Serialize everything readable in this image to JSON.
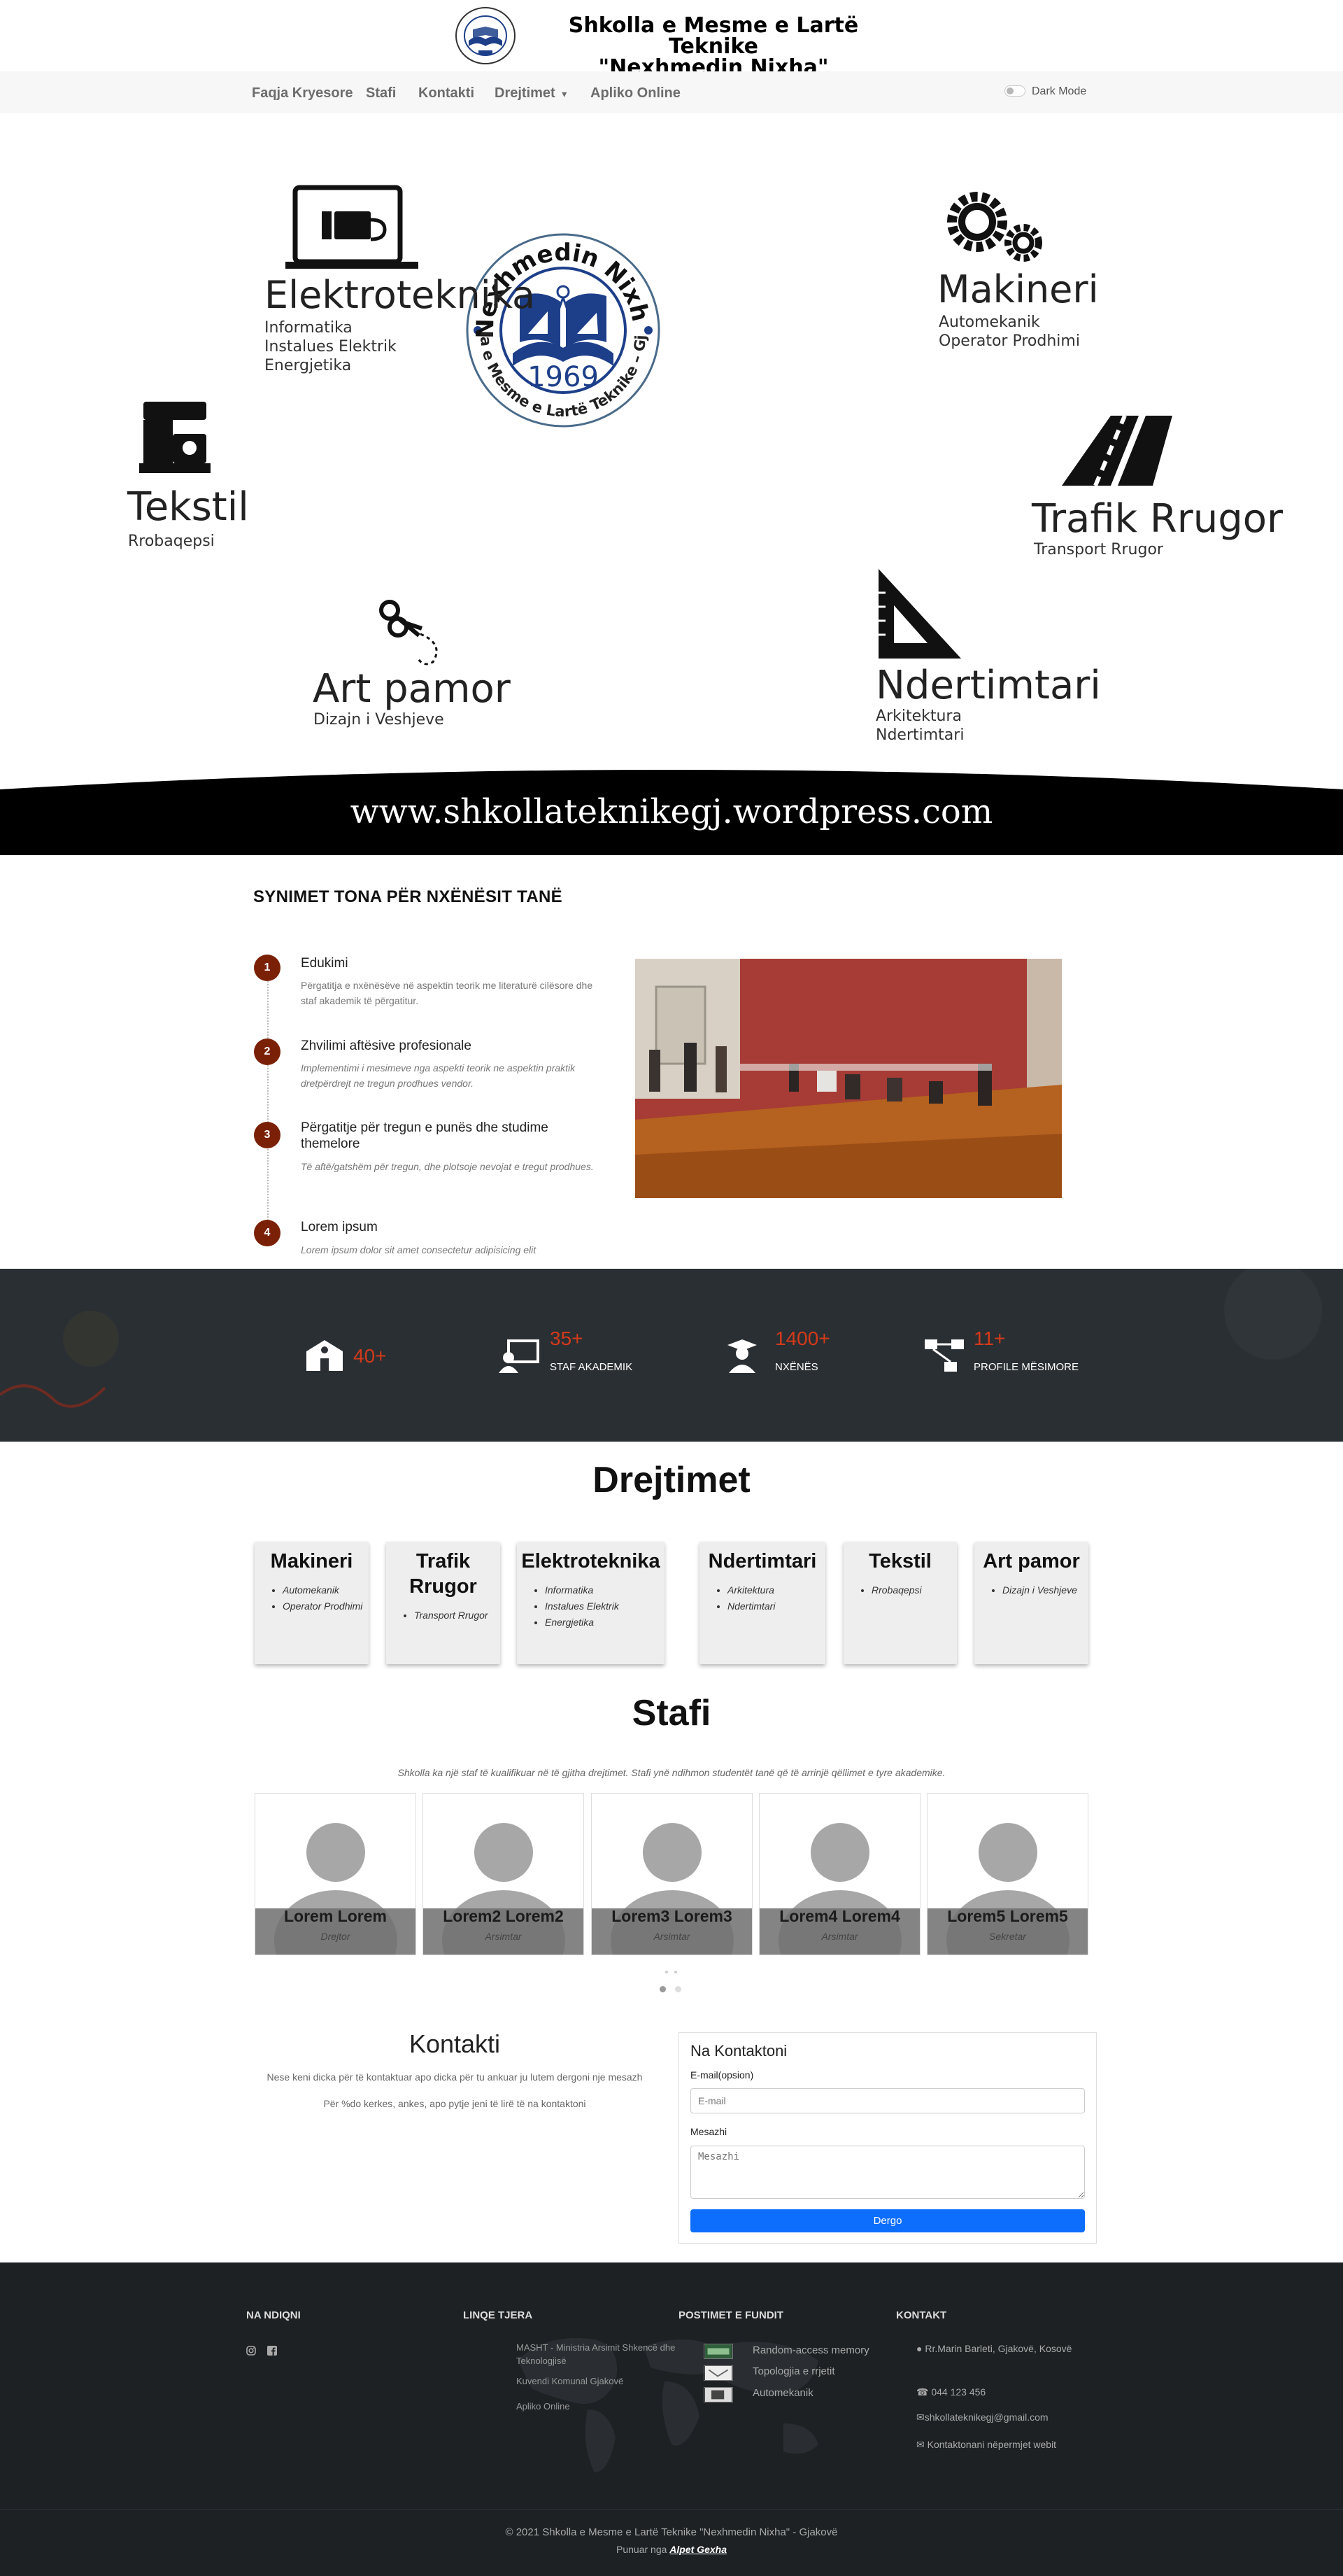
{
  "header": {
    "title_line1": "Shkolla e Mesme e Lartë Teknike",
    "title_line2": "\"Nexhmedin Nixha\"",
    "logo_text": "\"NEXHMEDIN NIXHA\" 1969"
  },
  "nav": {
    "items": [
      "Faqja Kryesore",
      "Stafi",
      "Kontakti",
      "Drejtimet",
      "Apliko Online"
    ],
    "dropdown_caret": "▾",
    "dark_mode_label": "Dark Mode"
  },
  "hero": {
    "emblem": {
      "top_arc": "\"Nexhmedin Nixha\"",
      "bottom_arc": "Shkolla e Mesme e Lartë Teknike – Gjakovë",
      "year": "1969"
    },
    "fields": [
      {
        "title": "Elektroteknika",
        "subs": [
          "Informatika",
          "Instalues Elektrik",
          "Energjetika"
        ]
      },
      {
        "title": "Makineri",
        "subs": [
          "Automekanik",
          "Operator Prodhimi"
        ]
      },
      {
        "title": "Tekstil",
        "subs": [
          "Rrobaqepsi"
        ]
      },
      {
        "title": "Trafik Rrugor",
        "subs": [
          "Transport Rrugor"
        ]
      },
      {
        "title": "Art pamor",
        "subs": [
          "Dizajn i Veshjeve"
        ]
      },
      {
        "title": "Ndertimtari",
        "subs": [
          "Arkitektura",
          "Ndertimtari"
        ]
      }
    ],
    "url": "www.shkollateknikegj.wordpress.com"
  },
  "goals": {
    "heading": "SYNIMET TONA PËR NXËNËSIT TANË",
    "steps": [
      {
        "num": "1",
        "title": "Edukimi",
        "desc": "Përgatitja e nxënësëve në aspektin teorik me literaturë cilësore dhe staf akademik të përgatitur."
      },
      {
        "num": "2",
        "title": "Zhvilimi aftësive profesionale",
        "desc": "Implementimi i mesimeve nga aspekti teorik ne aspektin praktik dretpërdrejt ne tregun prodhues vendor."
      },
      {
        "num": "3",
        "title": "Përgatitje për tregun e punës dhe studime themelore",
        "desc": "Të aftë/gatshëm për tregun, dhe plotsoje nevojat e tregut prodhues."
      },
      {
        "num": "4",
        "title": "Lorem ipsum",
        "desc": "Lorem ipsum dolor sit amet consectetur adipisicing elit"
      }
    ]
  },
  "stats": [
    {
      "icon": "school-icon",
      "number": "40+",
      "label": ""
    },
    {
      "icon": "teacher-icon",
      "number": "35+",
      "label": "STAF AKADEMIK"
    },
    {
      "icon": "student-icon",
      "number": "1400+",
      "label": "NXËNËS"
    },
    {
      "icon": "sitemap-icon",
      "number": "11+",
      "label": "PROFILE MËSIMORE"
    }
  ],
  "directions": {
    "heading": "Drejtimet",
    "cards": [
      {
        "title": "Makineri",
        "items": [
          "Automekanik",
          "Operator Prodhimi"
        ]
      },
      {
        "title": "Trafik Rrugor",
        "items": [
          "Transport Rrugor"
        ]
      },
      {
        "title": "Elektroteknika",
        "items": [
          "Informatika",
          "Instalues Elektrik",
          "Energjetika"
        ]
      },
      {
        "title": "Ndertimtari",
        "items": [
          "Arkitektura",
          "Ndertimtari"
        ]
      },
      {
        "title": "Tekstil",
        "items": [
          "Rrobaqepsi"
        ]
      },
      {
        "title": "Art pamor",
        "items": [
          "Dizajn i Veshjeve"
        ]
      }
    ]
  },
  "staff": {
    "heading": "Stafi",
    "intro": "Shkolla ka një staf të kualifikuar në të gjitha drejtimet. Stafi ynë ndihmon studentët tanë që të arrinjë qëllimet e tyre akademike.",
    "members": [
      {
        "name": "Lorem Lorem",
        "role": "Drejtor"
      },
      {
        "name": "Lorem2 Lorem2",
        "role": "Arsimtar"
      },
      {
        "name": "Lorem3 Lorem3",
        "role": "Arsimtar"
      },
      {
        "name": "Lorem4 Lorem4",
        "role": "Arsimtar"
      },
      {
        "name": "Lorem5 Lorem5",
        "role": "Sekretar"
      }
    ]
  },
  "contact": {
    "heading": "Kontakti",
    "text1": "Nese keni dicka për të kontaktuar apo dicka për tu ankuar ju lutem dergoni nje mesazh",
    "text2": "Për %do kerkes, ankes, apo pytje jeni të lirë të na kontaktoni",
    "form_title": "Na Kontaktoni",
    "email_label": "E-mail(opsion)",
    "email_placeholder": "E-mail",
    "message_label": "Mesazhi",
    "message_placeholder": "Mesazhi",
    "send_label": "Dergo"
  },
  "footer": {
    "follow_heading": "NA NDIQNI",
    "links_heading": "LINQE TJERA",
    "links": [
      "MASHT - Ministria Arsimit Shkencë dhe Teknologjisë",
      "Kuvendi Komunal Gjakovë",
      "Apliko Online"
    ],
    "posts_heading": "POSTIMET E FUNDIT",
    "posts": [
      "Random-access memory",
      "Topologjia e rrjetit",
      "Automekanik"
    ],
    "contact_heading": "KONTAKT",
    "address": "Rr.Marin Barleti, Gjakovë, Kosovë",
    "phone": "044 123 456",
    "email": "shkollateknikegj@gmail.com",
    "contact_link": "Kontaktonani nëpermjet webit",
    "copyright": "© 2021 Shkolla e Mesme e Lartë Teknike \"Nexhmedin Nixha\" - Gjakovë",
    "credit_prefix": "Punuar nga",
    "credit_name": "Alpet Gexha"
  }
}
